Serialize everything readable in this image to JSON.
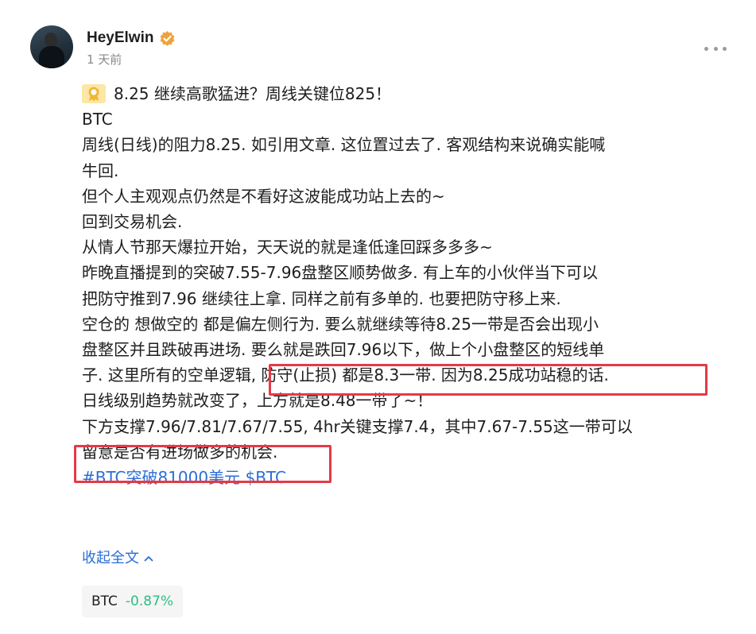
{
  "post": {
    "author": {
      "name": "HeyElwin",
      "verified_icon": "verified-badge-icon",
      "badge_color": "#f0a23b"
    },
    "timestamp": "1 天前",
    "menu_icon": "more-horizontal-icon",
    "lines": {
      "title": "8.25 继续高歌猛进？周线关键位825！",
      "l1": "BTC",
      "l2": "周线(日线)的阻力8.25. 如引用文章. 这位置过去了. 客观结构来说确实能喊",
      "l3": "牛回.",
      "l4": "但个人主观观点仍然是不看好这波能成功站上去的~",
      "l5": "回到交易机会.",
      "l6": "从情人节那天爆拉开始，天天说的就是逢低逢回踩多多多~",
      "l7": "昨晚直播提到的突破7.55-7.96盘整区顺势做多. 有上车的小伙伴当下可以",
      "l8": "把防守推到7.96 继续往上拿. 同样之前有多单的. 也要把防守移上来.",
      "l9": "空仓的 想做空的 都是偏左侧行为. 要么就继续等待8.25一带是否会出现小",
      "l10a": "盘整区并且跌破再进场",
      "l10b": ". 要么就是跌回7.96以下，做上个小盘整区的短线单",
      "l11": "子. 这里所有的空单逻辑, 防守(止损) 都是8.3一带. 因为8.25成功站稳的话.",
      "l12": "日线级别趋势就改变了，上方就是8.48一带了~！",
      "l13a": "下方支撑7.96/7.81/7.67/7.55,",
      "l13b": " 4hr关键支撑7.4，其中7.67-7.55这一带可以",
      "l14": "留意是否有进场做多的机会.",
      "hashtag": "#BTC突破81000美元",
      "cashtag": "$BTC"
    },
    "title_icon": "award-medal-icon",
    "collapse_label": "收起全文",
    "collapse_icon": "chevron-up-icon",
    "ticker": {
      "symbol": "BTC",
      "change": "-0.87%",
      "change_color": "#2ebd85"
    },
    "highlight_color": "#e63946",
    "link_color": "#2a6ed6"
  }
}
